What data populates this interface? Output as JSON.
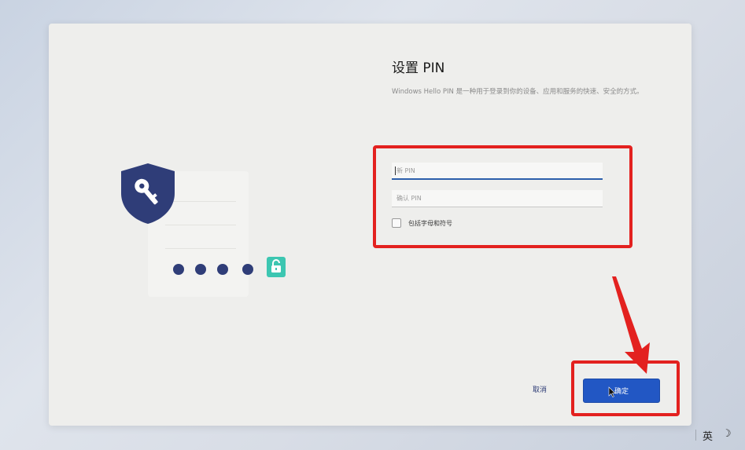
{
  "dialog": {
    "title": "设置 PIN",
    "description": "Windows Hello PIN 是一种用于登录到你的设备、应用和服务的快速、安全的方式。",
    "new_pin_placeholder": "新 PIN",
    "confirm_pin_placeholder": "确认 PIN",
    "include_letters_label": "包括字母和符号",
    "include_letters_checked": false,
    "cancel_label": "取消",
    "ok_label": "确定"
  },
  "illustration": {
    "pin_dot_count": 4,
    "shield_icon": "shield-key-icon",
    "lock_icon": "unlocked-padlock-icon"
  },
  "annotations": {
    "highlight_color": "#e3211f"
  },
  "taskbar": {
    "ime_label": "英",
    "moon_glyph": "☽"
  },
  "colors": {
    "accent": "#2257c4",
    "navy": "#2f3d78",
    "teal": "#3cc6b1"
  }
}
